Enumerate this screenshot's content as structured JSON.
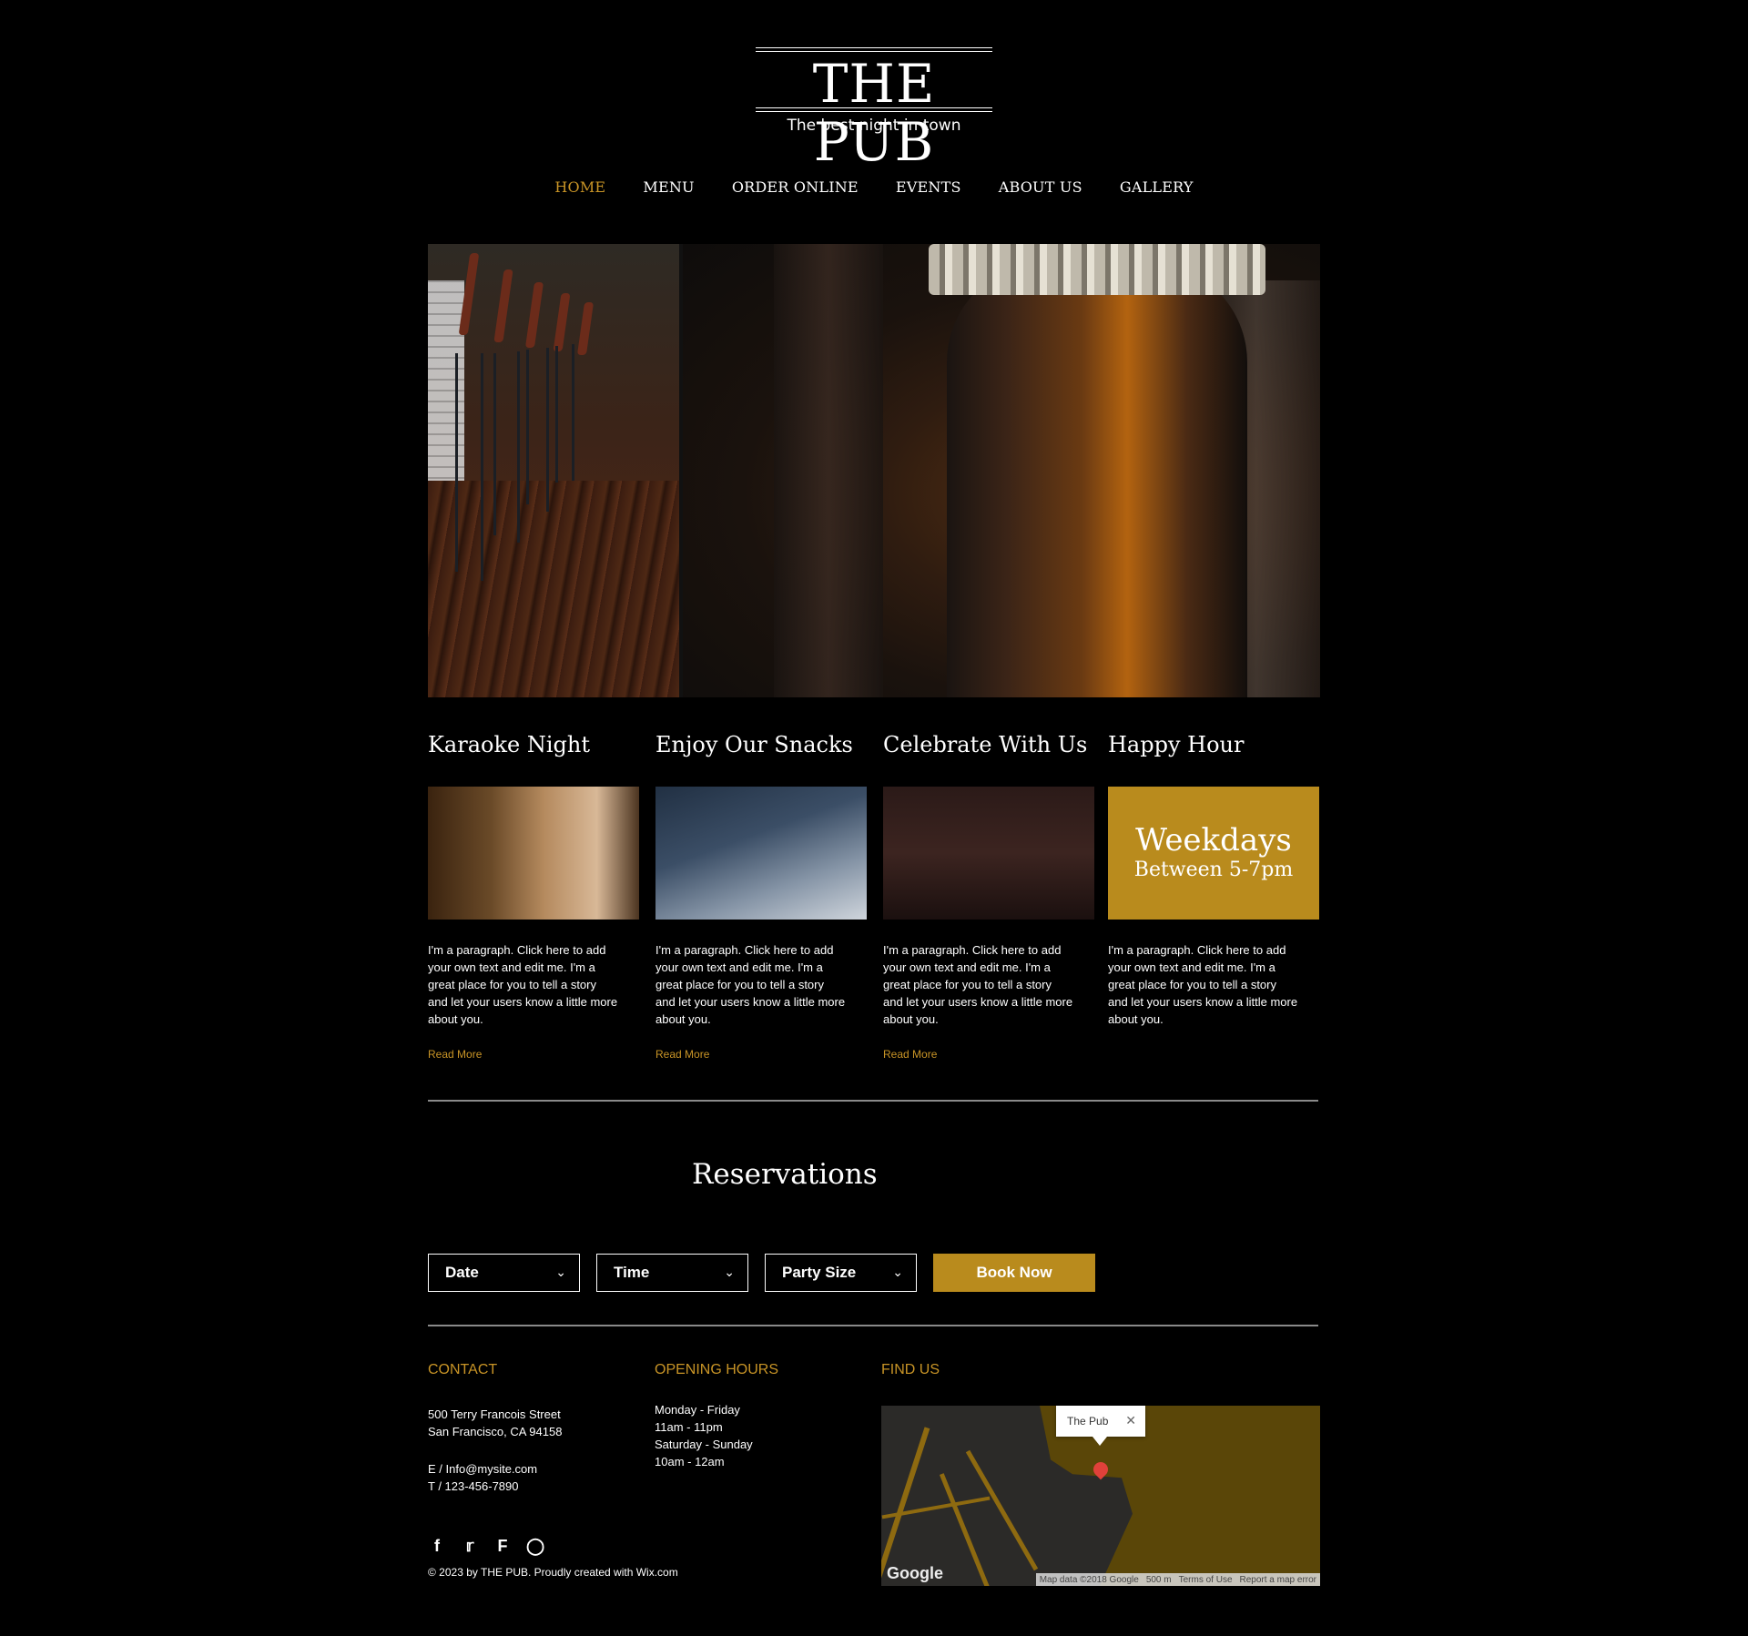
{
  "logo": {
    "title": "THE PUB",
    "tagline": "The best night in town"
  },
  "nav": {
    "items": [
      "HOME",
      "MENU",
      "ORDER ONLINE",
      "EVENTS",
      "ABOUT US",
      "GALLERY"
    ],
    "active": "HOME"
  },
  "features": [
    {
      "title": "Karaoke Night",
      "text": "I'm a paragraph. Click here to add your own text and edit me. I'm a great place for you to tell a story and let your users know a little more about you.",
      "link": "Read More"
    },
    {
      "title": "Enjoy Our Snacks",
      "text": "I'm a paragraph. Click here to add your own text and edit me. I'm a great place for you to tell a story and let your users know a little more about you.",
      "link": "Read More"
    },
    {
      "title": "Celebrate With Us",
      "text": "I'm a paragraph. Click here to add your own text and edit me. I'm a great place for you to tell a story and let your users know a little more about you.",
      "link": "Read More"
    },
    {
      "title": "Happy Hour",
      "banner_big": "Weekdays",
      "banner_small": "Between 5-7pm",
      "text": "I'm a paragraph. Click here to add your own text and edit me. I'm a great place for you to tell a story and let your users know a little more about you."
    }
  ],
  "reservations": {
    "title": "Reservations",
    "date": "Date",
    "time": "Time",
    "party": "Party Size",
    "book": "Book Now"
  },
  "footer": {
    "contact_heading": "CONTACT",
    "address1": "500 Terry Francois Street",
    "address2": "San Francisco, CA  94158",
    "email": "E  /  Info@mysite.com",
    "phone": "T  /  123-456-7890",
    "hours_heading": "OPENING HOURS",
    "hours1": "Monday - Friday",
    "hours2": "11am - 11pm",
    "hours3": "Saturday - Sunday",
    "hours4": "10am - 12am",
    "find_heading": "FIND US",
    "copyright": "© 2023 by  THE PUB. Proudly created with Wix.com",
    "social": [
      "facebook-icon",
      "twitter-icon",
      "foursquare-icon",
      "instagram-icon"
    ]
  },
  "map": {
    "popup": "The Pub",
    "google": "Google",
    "attr_data": "Map data ©2018 Google",
    "attr_scale": "500 m",
    "attr_terms": "Terms of Use",
    "attr_report": "Report a map error"
  },
  "colors": {
    "accent": "#c89426",
    "gold_banner": "#b98b1d",
    "background": "#000000"
  }
}
